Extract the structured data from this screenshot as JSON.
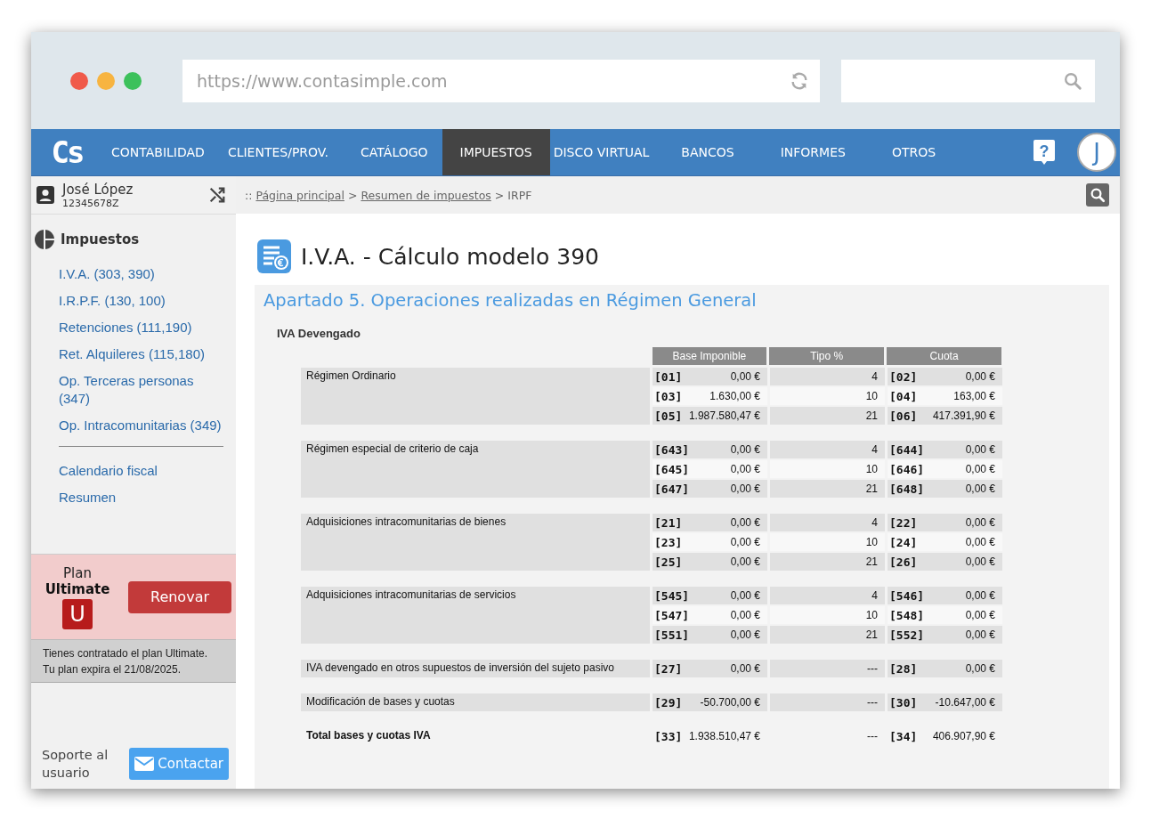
{
  "browser": {
    "url": "https://www.contasimple.com"
  },
  "nav": {
    "logo": "Cs",
    "avatar": "J",
    "help": "?",
    "items": [
      {
        "label": "CONTABILIDAD",
        "selected": false
      },
      {
        "label": "CLIENTES/PROV.",
        "selected": false
      },
      {
        "label": "CATÁLOGO",
        "selected": false
      },
      {
        "label": "IMPUESTOS",
        "selected": true
      },
      {
        "label": "DISCO VIRTUAL",
        "selected": false
      },
      {
        "label": "BANCOS",
        "selected": false
      },
      {
        "label": "INFORMES",
        "selected": false
      },
      {
        "label": "OTROS",
        "selected": false
      }
    ]
  },
  "user": {
    "name": "José López",
    "id": "12345678Z"
  },
  "breadcrumb": [
    {
      "kind": "sep",
      "text": "::"
    },
    {
      "kind": "link",
      "text": "Página principal"
    },
    {
      "kind": "sep",
      "text": ">"
    },
    {
      "kind": "link",
      "text": "Resumen de impuestos"
    },
    {
      "kind": "sep",
      "text": ">"
    },
    {
      "kind": "current",
      "text": "IRPF"
    }
  ],
  "sidebar": {
    "header": "Impuestos",
    "groups": [
      [
        "I.V.A. (303, 390)",
        "I.R.P.F. (130, 100)",
        "Retenciones (111,190)",
        "Ret. Alquileres (115,180)",
        "Op. Terceras personas (347)",
        "Op. Intracomunitarias (349)"
      ],
      [
        "Calendario fiscal",
        "Resumen"
      ]
    ]
  },
  "plan": {
    "label": "Plan",
    "name": "Ultimate",
    "badge": "U",
    "button": "Renovar",
    "notice": [
      "Tienes contratado el plan Ultimate.",
      "Tu plan expira el 21/08/2025."
    ]
  },
  "support": {
    "label": "Soporte al usuario",
    "button": "Contactar"
  },
  "page": {
    "title": "I.V.A. - Cálculo modelo 390"
  },
  "section": {
    "heading": "Apartado 5. Operaciones realizadas en Régimen General",
    "subheading": "IVA Devengado",
    "table": {
      "columns": [
        "Base Imponible",
        "Tipo %",
        "Cuota"
      ],
      "groups": [
        {
          "kind": "normal",
          "label": "Régimen Ordinario",
          "rows": [
            {
              "code": "[01]",
              "base": "0,00 €",
              "tipo": "4",
              "code2": "[02]",
              "cuota": "0,00 €"
            },
            {
              "code": "[03]",
              "base": "1.630,00 €",
              "tipo": "10",
              "code2": "[04]",
              "cuota": "163,00 €"
            },
            {
              "code": "[05]",
              "base": "1.987.580,47 €",
              "tipo": "21",
              "code2": "[06]",
              "cuota": "417.391,90 €"
            }
          ]
        },
        {
          "kind": "normal",
          "label": "Régimen especial de criterio de caja",
          "rows": [
            {
              "code": "[643]",
              "base": "0,00 €",
              "tipo": "4",
              "code2": "[644]",
              "cuota": "0,00 €"
            },
            {
              "code": "[645]",
              "base": "0,00 €",
              "tipo": "10",
              "code2": "[646]",
              "cuota": "0,00 €"
            },
            {
              "code": "[647]",
              "base": "0,00 €",
              "tipo": "21",
              "code2": "[648]",
              "cuota": "0,00 €"
            }
          ]
        },
        {
          "kind": "normal",
          "label": "Adquisiciones intracomunitarias de bienes",
          "rows": [
            {
              "code": "[21]",
              "base": "0,00 €",
              "tipo": "4",
              "code2": "[22]",
              "cuota": "0,00 €"
            },
            {
              "code": "[23]",
              "base": "0,00 €",
              "tipo": "10",
              "code2": "[24]",
              "cuota": "0,00 €"
            },
            {
              "code": "[25]",
              "base": "0,00 €",
              "tipo": "21",
              "code2": "[26]",
              "cuota": "0,00 €"
            }
          ]
        },
        {
          "kind": "normal",
          "label": "Adquisiciones intracomunitarias de servicios",
          "rows": [
            {
              "code": "[545]",
              "base": "0,00 €",
              "tipo": "4",
              "code2": "[546]",
              "cuota": "0,00 €"
            },
            {
              "code": "[547]",
              "base": "0,00 €",
              "tipo": "10",
              "code2": "[548]",
              "cuota": "0,00 €"
            },
            {
              "code": "[551]",
              "base": "0,00 €",
              "tipo": "21",
              "code2": "[552]",
              "cuota": "0,00 €"
            }
          ]
        },
        {
          "kind": "normal",
          "label": "IVA devengado en otros supuestos de inversión del sujeto pasivo",
          "rows": [
            {
              "code": "[27]",
              "base": "0,00 €",
              "tipo": "---",
              "code2": "[28]",
              "cuota": "0,00 €"
            }
          ]
        },
        {
          "kind": "normal",
          "label": "Modificación de bases y cuotas",
          "rows": [
            {
              "code": "[29]",
              "base": "-50.700,00 €",
              "tipo": "---",
              "code2": "[30]",
              "cuota": "-10.647,00 €"
            }
          ]
        },
        {
          "kind": "total",
          "label": "Total bases y cuotas IVA",
          "rows": [
            {
              "code": "[33]",
              "base": "1.938.510,47 €",
              "tipo": "---",
              "code2": "[34]",
              "cuota": "406.907,90 €"
            }
          ]
        }
      ]
    }
  }
}
